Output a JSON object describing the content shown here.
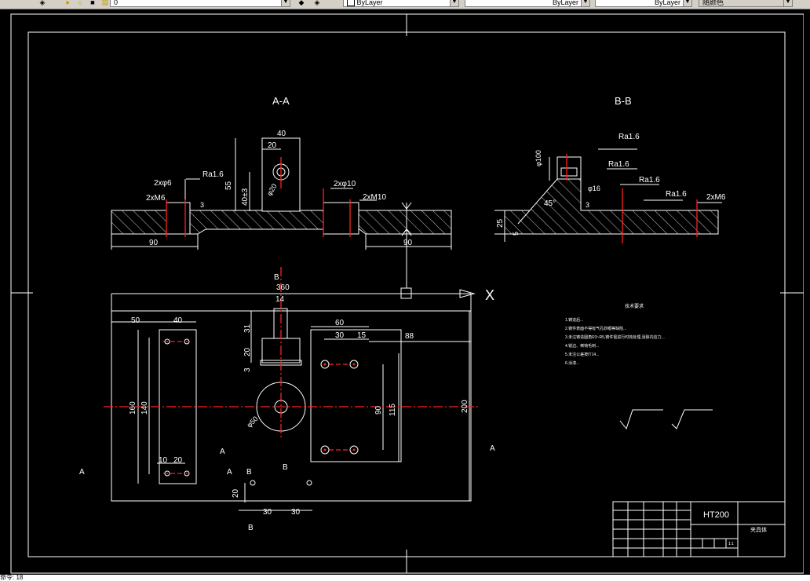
{
  "toolbar": {
    "layer_value": "0",
    "color_value": "ByLayer",
    "linetype_value": "ByLayer",
    "lineweight_value": "ByLayer",
    "plotstyle_value": "随颜色"
  },
  "drawing": {
    "section_aa_title": "A-A",
    "section_bb_title": "B-B",
    "material": "HT200",
    "part_name": "夹具体",
    "notes_title": "技术要求",
    "notes": [
      "1.铸造后...",
      "2.铸件表面不得有气孔砂眼等缺陷...",
      "3.未注铸造圆角R3~R5,铸件需进行时效处理,消除内应力...",
      "4.锐边、倒钝毛刺...",
      "5.未注公差按IT14...",
      "6.涂漆..."
    ],
    "roughness": "Ra1.6",
    "axis_label": "X",
    "scale": "1:1"
  },
  "dims": {
    "aa_40": "40",
    "aa_20": "20",
    "aa_55": "55",
    "aa_40h": "40±3",
    "aa_phi20": "φ20",
    "aa_3": "3",
    "aa_2xphi": "2xφ6",
    "aa_2xm6": "2xM6",
    "aa_2xphi10": "2xφ10",
    "aa_2xm10": "2xM10",
    "aa_90l": "90",
    "aa_90r": "90",
    "bb_phi100": "φ100",
    "bb_phi16": "φ16",
    "bb_2xm6": "2xM6",
    "bb_45": "45°",
    "bb_3": "3",
    "bb_25": "25",
    "bb_5": "5",
    "pv_360": "360",
    "pv_14": "14",
    "pv_50": "50",
    "pv_40": "40",
    "pv_60": "60",
    "pv_30": "30",
    "pv_15": "15",
    "pv_88": "88",
    "pv_31": "31",
    "pv_20": "20",
    "pv_3": "3",
    "pv_160": "160",
    "pv_140": "140",
    "pv_90": "90",
    "pv_115": "115",
    "pv_200": "200",
    "pv_phi50": "φ50",
    "pv_10": "10",
    "pv_20b": "20",
    "pv_20c": "20",
    "pv_30a": "30",
    "pv_30b": "30",
    "lbl_a1": "A",
    "lbl_a2": "A",
    "lbl_a3": "A",
    "lbl_b1": "B",
    "lbl_b2": "B",
    "lbl_b3": "B",
    "lbl_b4": "B"
  },
  "statusbar": {
    "text": "命令: 18"
  },
  "colors": {
    "line": "#ffffff",
    "center": "#ff2020",
    "hatch": "#ffffff",
    "ui": "#d4d0c8"
  }
}
